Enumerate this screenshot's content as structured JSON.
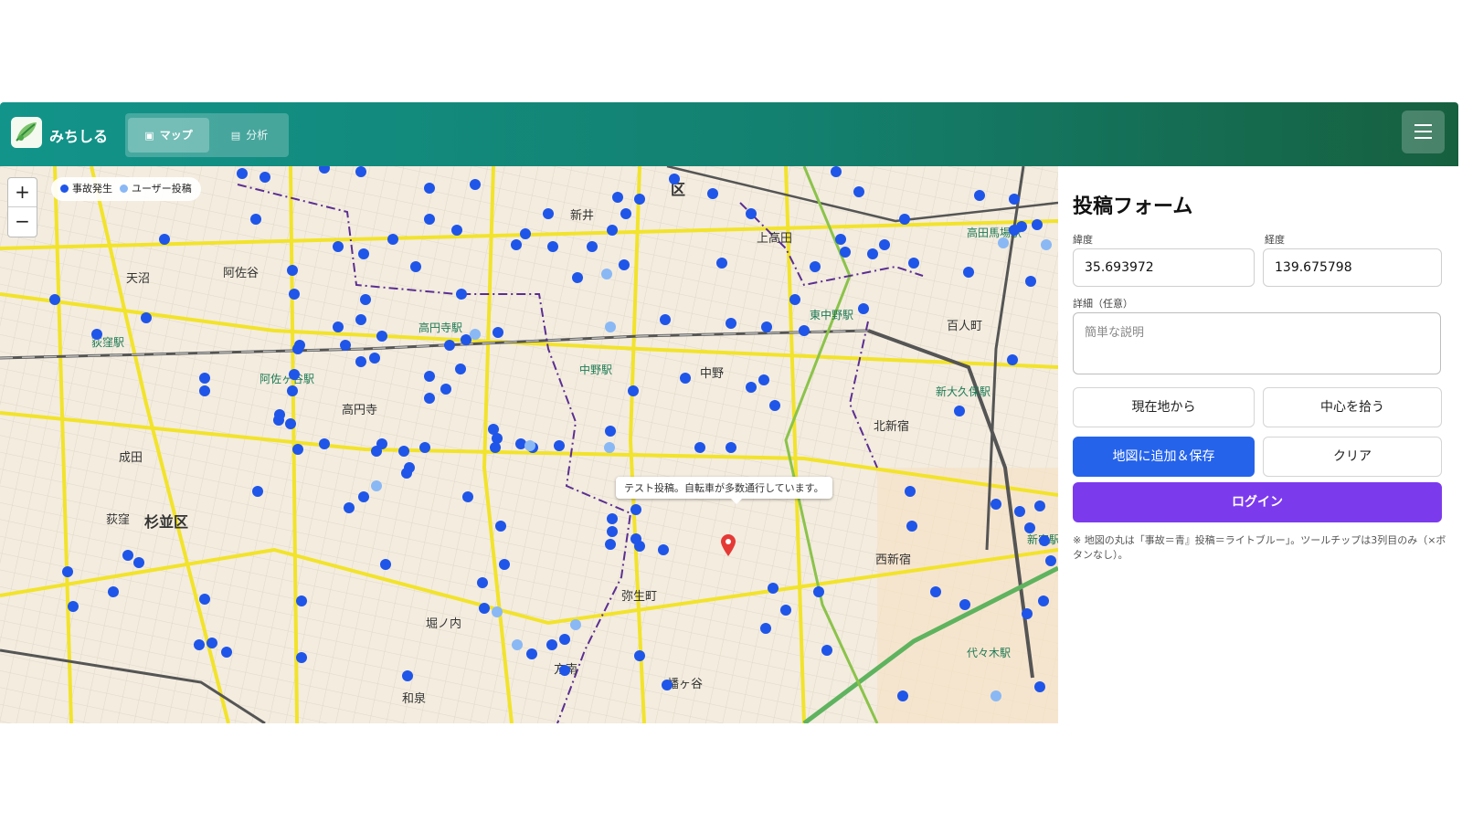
{
  "header": {
    "app_title": "みちしる",
    "tabs": [
      {
        "label": "マップ",
        "icon": "map-icon",
        "active": true
      },
      {
        "label": "分析",
        "icon": "chart-icon",
        "active": false
      }
    ],
    "menu_icon": "hamburger-icon",
    "brand_color": "#12948a"
  },
  "map": {
    "zoom_in": "+",
    "zoom_out": "−",
    "legend": [
      {
        "label": "事故発生",
        "color": "#1f55e8"
      },
      {
        "label": "ユーザー投稿",
        "color": "#8ab8f5"
      }
    ],
    "tooltip": "テスト投稿。自転車が多数通行しています。",
    "labels": {
      "nogata": "新井",
      "kamitakada": "上高田",
      "amanuma": "天沼",
      "asagaya": "阿佐谷",
      "ogikubo_st": "荻窪駅",
      "koenji_st": "高円寺駅",
      "asagaya_st": "阿佐ヶ谷駅",
      "koenji": "高円寺",
      "nakano_st": "中野駅",
      "nakano": "中野",
      "higashinakano_st": "東中野駅",
      "hyakunincho": "百人町",
      "takadanobaba_st": "高田馬場駅",
      "shinokubo_st": "新大久保駅",
      "kitashinjuku": "北新宿",
      "narita": "成田",
      "ogikubo": "荻窪",
      "suginami": "杉並区",
      "yayoicho": "弥生町",
      "horinouchi": "堀ノ内",
      "wada": "和泉",
      "nishishinjuku": "西新宿",
      "shinjuku_st": "新宿駅",
      "yoyogi": "代々木駅",
      "hatagaya": "幡ヶ谷",
      "honan": "方南",
      "nakano_ku": "区"
    },
    "accident_color": "#1f55e8",
    "post_color": "#8ab8f5",
    "pin_color": "#e53935"
  },
  "form": {
    "title": "投稿フォーム",
    "lat_label": "緯度",
    "lat_value": "35.693972",
    "lng_label": "経度",
    "lng_value": "139.675798",
    "detail_label": "詳細（任意）",
    "detail_placeholder": "簡単な説明",
    "btn_current": "現在地から",
    "btn_center": "中心を拾う",
    "btn_add": "地図に追加＆保存",
    "btn_clear": "クリア",
    "btn_login": "ログイン",
    "note": "※ 地図の丸は「事故＝青』投稿＝ライトブルー」。ツールチップは3列目のみ（×ボタンなし）。"
  }
}
